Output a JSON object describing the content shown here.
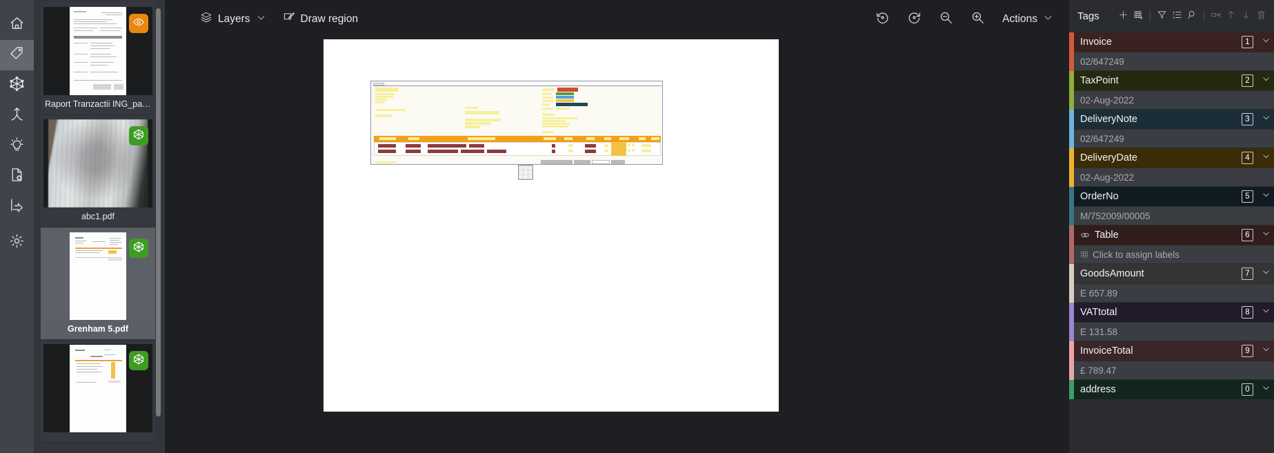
{
  "rail": {
    "items": [
      {
        "name": "home-icon",
        "label": "Home",
        "active": false
      },
      {
        "name": "tag-icon",
        "label": "Tags",
        "active": true
      },
      {
        "name": "model-icon",
        "label": "Model",
        "active": false
      },
      {
        "name": "merge-icon",
        "label": "Merge",
        "active": false
      },
      {
        "name": "lightbulb-icon",
        "label": "Insights",
        "active": false
      },
      {
        "name": "document-settings-icon",
        "label": "Document settings",
        "active": false
      },
      {
        "name": "export-icon",
        "label": "Export",
        "active": false
      },
      {
        "name": "gear-icon",
        "label": "Settings",
        "active": false
      }
    ]
  },
  "documents": [
    {
      "name": "Raport Tranzactii ING_page_1....",
      "badge": "preview-badge",
      "badge_color": "#e8880f",
      "selected": false,
      "thumb": "scan-invoice"
    },
    {
      "name": "abc1.pdf",
      "badge": "model-badge",
      "badge_color": "#3f9c23",
      "selected": false,
      "thumb": "photo-receipt"
    },
    {
      "name": "Grenham 5.pdf",
      "badge": "model-badge",
      "badge_color": "#3f9c23",
      "selected": true,
      "thumb": "invoice-wide"
    },
    {
      "name": "",
      "badge": "model-badge",
      "badge_color": "#3f9c23",
      "selected": false,
      "thumb": "invoice-table"
    }
  ],
  "toolbar": {
    "layers_label": "Layers",
    "draw_region_label": "Draw region",
    "actions_label": "Actions",
    "rotate_left": "rotate-left-icon",
    "rotate_right": "rotate-right-icon",
    "zoom_out": "zoom-out-icon",
    "zoom_in": "zoom-in-icon"
  },
  "tags_panel": {
    "title": "Tags",
    "tools": [
      {
        "name": "add-tag-icon",
        "dim": false
      },
      {
        "name": "add-table-tag-icon",
        "dim": false
      },
      {
        "name": "filter-icon",
        "dim": false
      },
      {
        "name": "list-view-icon",
        "dim": false
      },
      {
        "name": "search-icon",
        "dim": false
      },
      {
        "name": "rename-tag-icon",
        "dim": true
      },
      {
        "name": "move-up-icon",
        "dim": true
      },
      {
        "name": "move-down-icon",
        "dim": true
      },
      {
        "name": "delete-tag-icon",
        "dim": true
      }
    ],
    "tags": [
      {
        "label": "Invoice",
        "index": "1",
        "value": "02/647249",
        "color": "#d35a3a",
        "header_bg": "#3a2220",
        "is_table": false
      },
      {
        "label": "TaxPoint",
        "index": "2",
        "value": "02-Aug-2022",
        "color": "#8fae3c",
        "header_bg": "#25290f",
        "is_table": false
      },
      {
        "label": "DeliveryNote",
        "index": "3",
        "value": "02/647249",
        "color": "#6fb4e0",
        "header_bg": "#1b2e38",
        "is_table": false
      },
      {
        "label": "DeliveryDate",
        "index": "4",
        "value": "02-Aug-2022",
        "color": "#f0b32c",
        "header_bg": "#3a2c06",
        "is_table": false
      },
      {
        "label": "OrderNo",
        "index": "5",
        "value": "M/752009/00005",
        "color": "#3c7585",
        "header_bg": "#111c22",
        "is_table": false
      },
      {
        "label": "Table",
        "index": "6",
        "value": "Click to assign labels",
        "color": "#b06a64",
        "header_bg": "#301d1c",
        "is_table": true
      },
      {
        "label": "GoodsAmount",
        "index": "7",
        "value": "E 657.89",
        "color": "#d9cfc0",
        "header_bg": "#343434",
        "is_table": false
      },
      {
        "label": "VATtotal",
        "index": "8",
        "value": "E 131.58",
        "color": "#9a87cf",
        "header_bg": "#211b2c",
        "is_table": false
      },
      {
        "label": "InvoiceTotal",
        "index": "9",
        "value": "£ 789.47",
        "color": "#eba6ab",
        "header_bg": "#3a2529",
        "is_table": false
      },
      {
        "label": "address",
        "index": "0",
        "value": "",
        "color": "#3f9c6a",
        "header_bg": "#13261d",
        "is_table": false
      }
    ]
  }
}
